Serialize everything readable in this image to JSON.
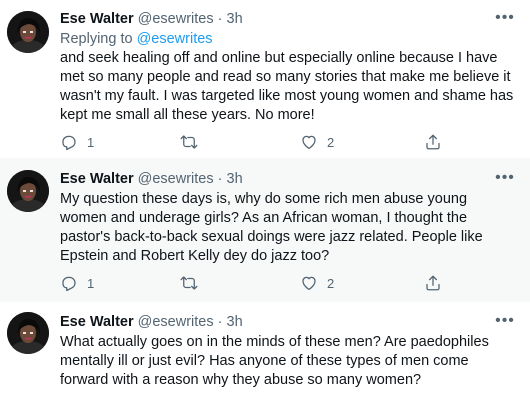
{
  "tweets": [
    {
      "name": "Ese Walter",
      "handle": "@esewrites",
      "dot": "·",
      "time": "3h",
      "replying_prefix": "Replying to ",
      "replying_to": "@esewrites",
      "text": "and seek healing off and online but especially online because I have met so many people and read so many stories that make me believe it wasn't my fault. I was targeted like most young women and shame has kept me small all these years. No more!",
      "reply_count": "1",
      "retweet_count": "",
      "like_count": "2"
    },
    {
      "name": "Ese Walter",
      "handle": "@esewrites",
      "dot": "·",
      "time": "3h",
      "text": "My question these days is, why do some rich men abuse young women and underage girls? As an African woman, I thought the pastor's back-to-back sexual doings were jazz related. People like Epstein and Robert Kelly dey do jazz too?",
      "reply_count": "1",
      "retweet_count": "",
      "like_count": "2"
    },
    {
      "name": "Ese Walter",
      "handle": "@esewrites",
      "dot": "·",
      "time": "3h",
      "text": "What actually goes on in the minds of these men? Are paedophiles mentally ill or just evil? Has anyone of these types of men come forward with a reason why they abuse so many women?"
    }
  ],
  "icons": {
    "more": "more-icon",
    "reply": "reply-icon",
    "retweet": "retweet-icon",
    "like": "like-icon",
    "share": "share-icon"
  },
  "colors": {
    "text": "#0f1419",
    "secondary": "#536471",
    "link": "#1d9bf0",
    "hover_bg": "#f7f9f9"
  }
}
